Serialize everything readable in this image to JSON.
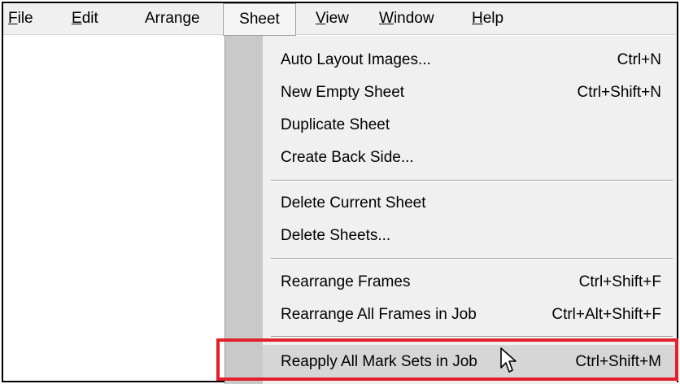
{
  "menubar": {
    "items": [
      {
        "label": "File",
        "mnemonic_index": 0
      },
      {
        "label": "Edit",
        "mnemonic_index": 0
      },
      {
        "label": "Arrange"
      },
      {
        "label": "Sheet",
        "active": true
      },
      {
        "label": "View",
        "mnemonic_index": 0
      },
      {
        "label": "Window",
        "mnemonic_index": 0
      },
      {
        "label": "Help",
        "mnemonic_index": 0
      }
    ]
  },
  "sheet_menu": {
    "groups": [
      [
        {
          "label": "Auto Layout Images...",
          "shortcut": "Ctrl+N"
        },
        {
          "label": "New Empty Sheet",
          "shortcut": "Ctrl+Shift+N"
        },
        {
          "label": "Duplicate Sheet",
          "shortcut": ""
        },
        {
          "label": "Create Back Side...",
          "shortcut": ""
        }
      ],
      [
        {
          "label": "Delete Current Sheet",
          "shortcut": ""
        },
        {
          "label": "Delete Sheets...",
          "shortcut": ""
        }
      ],
      [
        {
          "label": "Rearrange Frames",
          "shortcut": "Ctrl+Shift+F"
        },
        {
          "label": "Rearrange All Frames in Job",
          "shortcut": "Ctrl+Alt+Shift+F"
        }
      ],
      [
        {
          "label": "Reapply All Mark Sets in Job",
          "shortcut": "Ctrl+Shift+M",
          "highlighted": true
        }
      ]
    ]
  },
  "colors": {
    "highlight_border": "#e0202a",
    "menu_bg": "#f0f0f0",
    "gutter": "#c9c9c9"
  },
  "icons": {
    "cursor": "mouse-pointer-icon"
  }
}
